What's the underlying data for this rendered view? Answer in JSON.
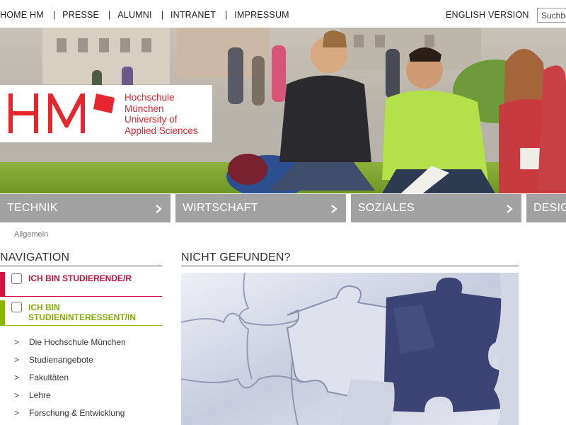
{
  "topnav": {
    "items": [
      "HOME HM",
      "PRESSE",
      "ALUMNI",
      "INTRANET",
      "IMPRESSUM"
    ],
    "separator": "|",
    "language_link": "ENGLISH VERSION",
    "search_placeholder": "Suchbegriff"
  },
  "logo": {
    "mark": "HM",
    "line1": "Hochschule",
    "line2": "München",
    "line3": "University of",
    "line4": "Applied Sciences",
    "color": "#e5262f"
  },
  "tabs": [
    {
      "label": "Technik"
    },
    {
      "label": "Wirtschaft"
    },
    {
      "label": "Soziales"
    },
    {
      "label": "Design"
    }
  ],
  "breadcrumb": "Allgemein",
  "sidebar": {
    "title": "NAVIGATION",
    "student_label": "ICH BIN STUDIERENDE/R",
    "student_color": "#d5123b",
    "prospect_line1": "ICH BIN",
    "prospect_line2": "STUDIENINTERESSENT/IN",
    "prospect_color": "#8ab800",
    "link_arrow": ">",
    "links": [
      "Die Hochschule München",
      "Studienangebote",
      "Fakultäten",
      "Lehre",
      "Forschung & Entwicklung"
    ]
  },
  "main": {
    "title": "NICHT GEFUNDEN?"
  },
  "icons": {
    "tab_chevron": "chevron-right-icon",
    "checkbox": "checkbox-icon"
  }
}
